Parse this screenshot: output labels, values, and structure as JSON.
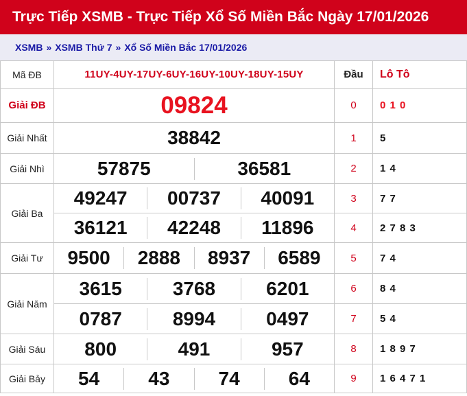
{
  "header": {
    "title": "Trực Tiếp XSMB - Trực Tiếp Xổ Số Miền Bắc Ngày 17/01/2026"
  },
  "breadcrumb": {
    "items": [
      "XSMB",
      "XSMB Thứ 7",
      "Xổ Số Miền Bắc 17/01/2026"
    ],
    "separator": "»"
  },
  "table": {
    "code_label": "Mã ĐB",
    "code_value": "11UY-4UY-17UY-6UY-16UY-10UY-18UY-15UY",
    "dau_header": "Đầu",
    "loto_header": "Lô Tô",
    "prizes": {
      "db": {
        "label": "Giải ĐB",
        "numbers": [
          "09824"
        ]
      },
      "nhat": {
        "label": "Giải Nhất",
        "numbers": [
          "38842"
        ]
      },
      "nhi": {
        "label": "Giải Nhì",
        "numbers": [
          "57875",
          "36581"
        ]
      },
      "ba": {
        "label": "Giải Ba",
        "numbers": [
          "49247",
          "00737",
          "40091",
          "36121",
          "42248",
          "11896"
        ]
      },
      "tu": {
        "label": "Giải Tư",
        "numbers": [
          "9500",
          "2888",
          "8937",
          "6589"
        ]
      },
      "nam": {
        "label": "Giải Năm",
        "numbers": [
          "3615",
          "3768",
          "6201",
          "0787",
          "8994",
          "0497"
        ]
      },
      "sau": {
        "label": "Giải Sáu",
        "numbers": [
          "800",
          "491",
          "957"
        ]
      },
      "bay": {
        "label": "Giải Bảy",
        "numbers": [
          "54",
          "43",
          "74",
          "64"
        ]
      }
    },
    "loto": [
      {
        "dau": "0",
        "values": "0 1 0"
      },
      {
        "dau": "1",
        "values": "5"
      },
      {
        "dau": "2",
        "values": "1 4"
      },
      {
        "dau": "3",
        "values": "7 7"
      },
      {
        "dau": "4",
        "values": "2 7 8 3"
      },
      {
        "dau": "5",
        "values": "7 4"
      },
      {
        "dau": "6",
        "values": "8 4"
      },
      {
        "dau": "7",
        "values": "5 4"
      },
      {
        "dau": "8",
        "values": "1 8 9 7"
      },
      {
        "dau": "9",
        "values": "1 6 4 7 1"
      }
    ]
  },
  "colors": {
    "title_bg": "#d0021b",
    "breadcrumb_bg": "#ebebf5",
    "breadcrumb_text": "#1a1aa6",
    "special_prize": "#e8121f"
  }
}
